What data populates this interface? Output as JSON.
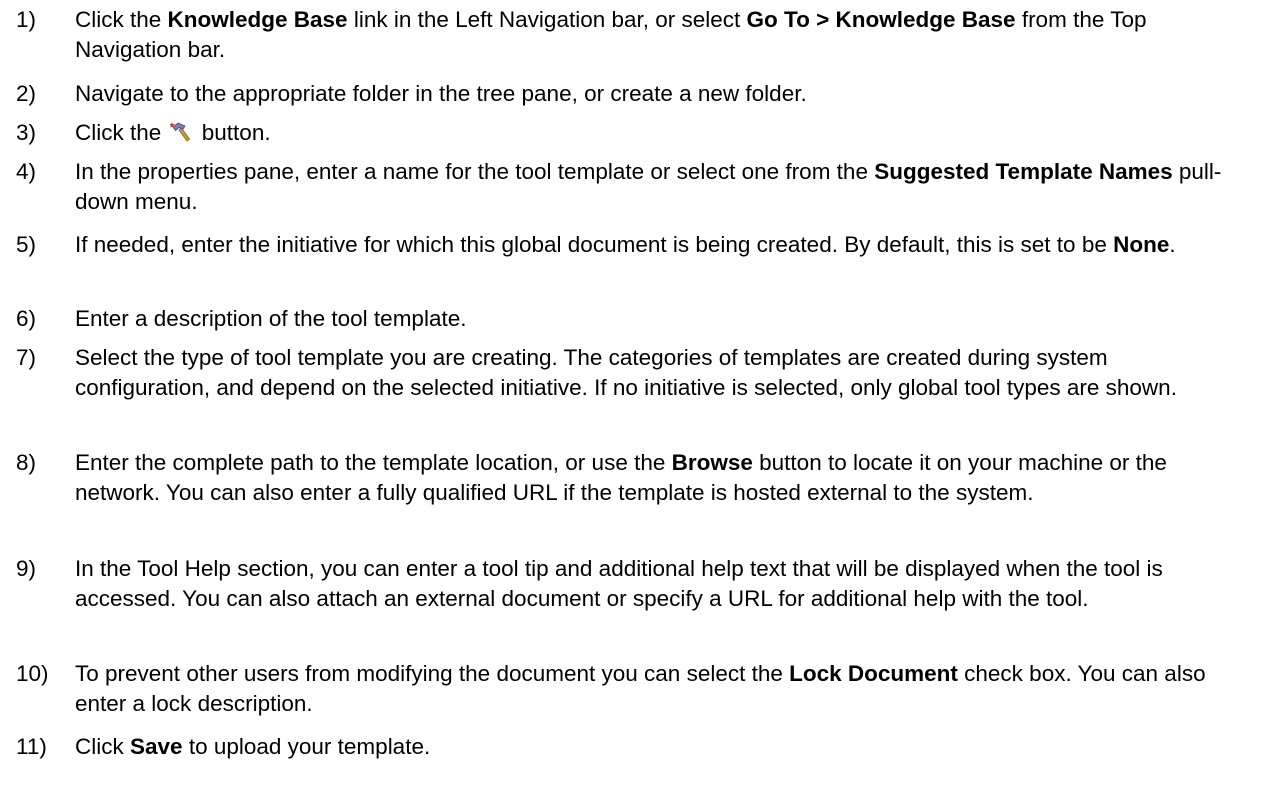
{
  "steps": [
    {
      "number": "1)",
      "parts": [
        {
          "text": "Click the "
        },
        {
          "text": "Knowledge Base",
          "bold": true
        },
        {
          "text": " link in the Left Navigation bar, or select "
        },
        {
          "text": "Go To > Knowledge Base",
          "bold": true
        },
        {
          "text": " from the Top Navigation bar."
        }
      ]
    },
    {
      "number": "2)",
      "parts": [
        {
          "text": "Navigate to the appropriate folder in the tree pane, or create a new folder."
        }
      ]
    },
    {
      "number": "3)",
      "parts": [
        {
          "text": "Click the "
        },
        {
          "icon": "hammer-icon"
        },
        {
          "text": " button."
        }
      ]
    },
    {
      "number": "4)",
      "parts": [
        {
          "text": "In the properties pane, enter a name for the tool template or select one from the "
        },
        {
          "text": "Suggested Template Names",
          "bold": true
        },
        {
          "text": " pull-down menu."
        }
      ]
    },
    {
      "number": "5)",
      "parts": [
        {
          "text": "If needed, enter the initiative for which this global document is being created. By default, this is set to be "
        },
        {
          "text": "None",
          "bold": true
        },
        {
          "text": "."
        }
      ]
    },
    {
      "number": "6)",
      "parts": [
        {
          "text": "Enter a description of the tool template."
        }
      ]
    },
    {
      "number": "7)",
      "parts": [
        {
          "text": "Select the type of tool template you are creating. The categories of templates are created during system configuration, and depend on the selected initiative. If no initiative is selected, only global tool types are shown."
        }
      ]
    },
    {
      "number": "8)",
      "parts": [
        {
          "text": "Enter the complete path to the template location, or use the "
        },
        {
          "text": "Browse",
          "bold": true
        },
        {
          "text": " button to locate it on your machine or the network. You can also enter a fully qualified URL if the template is hosted external to the system."
        }
      ]
    },
    {
      "number": "9)",
      "parts": [
        {
          "text": "In the Tool Help section, you can enter a tool tip and additional help text that will be displayed when the tool is accessed. You can also attach an external document or specify a URL for additional help with the tool."
        }
      ]
    },
    {
      "number": "10)",
      "parts": [
        {
          "text": "To prevent other users from modifying the document you can select the "
        },
        {
          "text": "Lock Document",
          "bold": true
        },
        {
          "text": " check box. You can also enter a lock description."
        }
      ]
    },
    {
      "number": "11)",
      "parts": [
        {
          "text": "Click "
        },
        {
          "text": "Save",
          "bold": true
        },
        {
          "text": " to upload your template."
        }
      ]
    }
  ],
  "icon_colors": {
    "hammer_head": "#7a7fb8",
    "hammer_handle": "#c99a3a",
    "sparkle": "#c23b3b"
  }
}
